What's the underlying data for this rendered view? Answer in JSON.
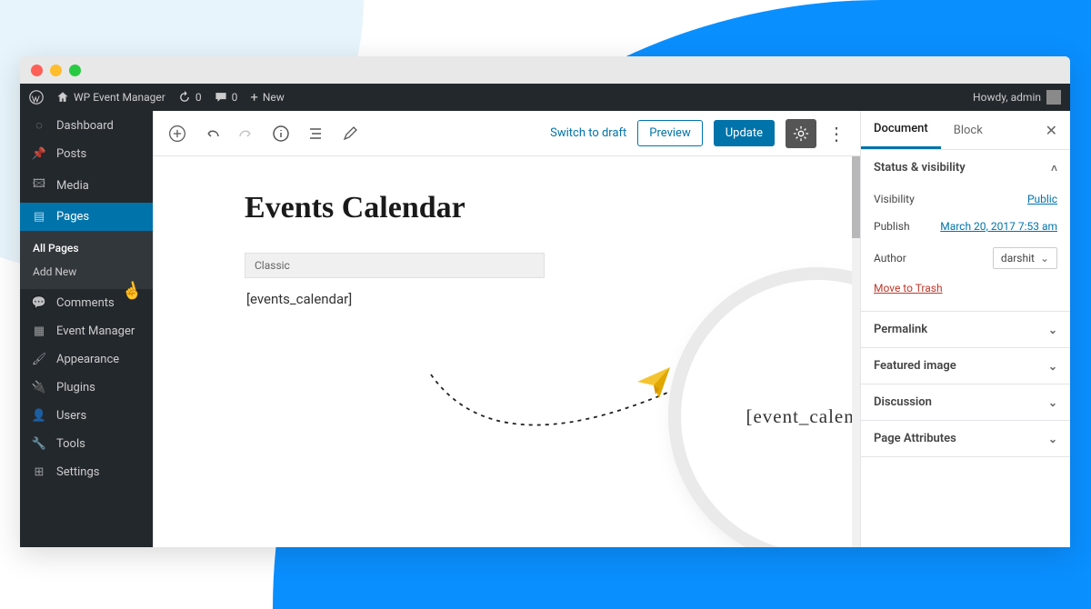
{
  "adminbar": {
    "site_name": "WP Event Manager",
    "refresh_count": "0",
    "comment_count": "0",
    "new_label": "New",
    "howdy": "Howdy, admin"
  },
  "sidebar": {
    "items": [
      {
        "icon": "speedometer",
        "label": "Dashboard"
      },
      {
        "icon": "pin",
        "label": "Posts"
      },
      {
        "icon": "media",
        "label": "Media"
      },
      {
        "icon": "page",
        "label": "Pages",
        "active": true
      },
      {
        "icon": "comment",
        "label": "Comments"
      },
      {
        "icon": "calendar",
        "label": "Event Manager"
      },
      {
        "icon": "brush",
        "label": "Appearance"
      },
      {
        "icon": "plug",
        "label": "Plugins"
      },
      {
        "icon": "user",
        "label": "Users"
      },
      {
        "icon": "wrench",
        "label": "Tools"
      },
      {
        "icon": "sliders",
        "label": "Settings"
      }
    ],
    "sub": {
      "all": "All Pages",
      "add": "Add New"
    }
  },
  "toolbar": {
    "switch_draft": "Switch to draft",
    "preview": "Preview",
    "update": "Update"
  },
  "page": {
    "title": "Events Calendar",
    "block_type": "Classic",
    "shortcode": "[events_calendar]"
  },
  "callout": {
    "text": "[event_calendar]"
  },
  "panel": {
    "tabs": {
      "doc": "Document",
      "block": "Block"
    },
    "status_head": "Status & visibility",
    "visibility_label": "Visibility",
    "visibility_value": "Public",
    "publish_label": "Publish",
    "publish_value": "March 20, 2017 7:53 am",
    "author_label": "Author",
    "author_value": "darshit",
    "trash": "Move to Trash",
    "sections": [
      "Permalink",
      "Featured image",
      "Discussion",
      "Page Attributes"
    ]
  }
}
